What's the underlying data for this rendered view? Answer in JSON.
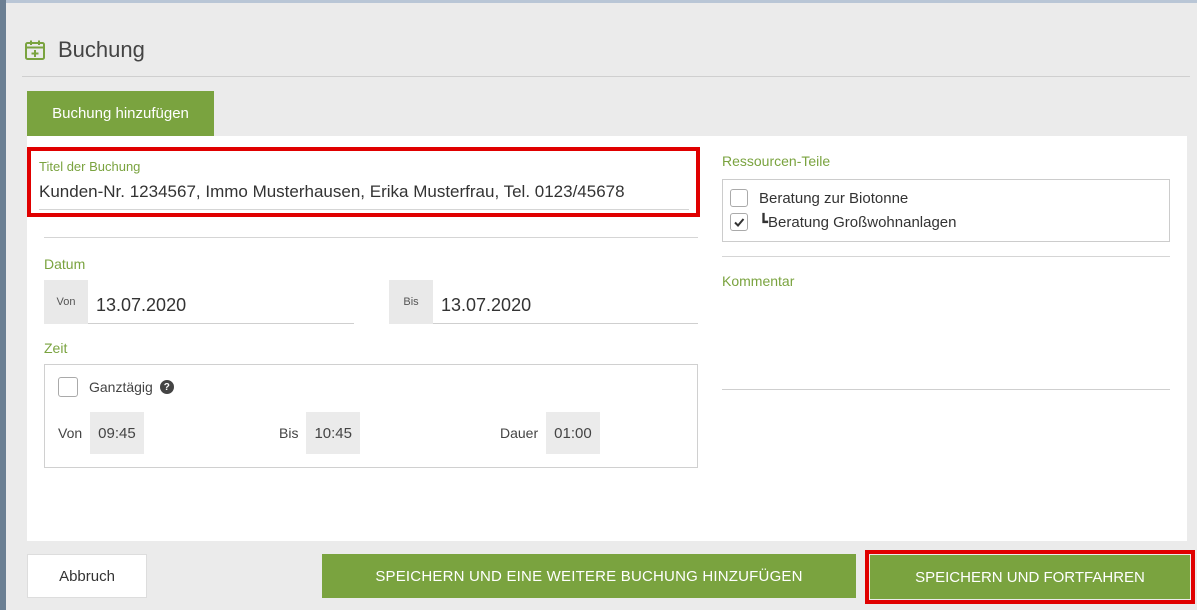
{
  "header": {
    "title": "Buchung",
    "icon": "calendar-plus-icon"
  },
  "tab": {
    "label": "Buchung hinzufügen"
  },
  "form": {
    "title_field": {
      "label": "Titel der Buchung",
      "value": "Kunden-Nr. 1234567, Immo Musterhausen, Erika Musterfrau, Tel. 0123/45678"
    },
    "datum": {
      "label": "Datum",
      "from_prefix": "Von",
      "from_value": "13.07.2020",
      "to_prefix": "Bis",
      "to_value": "13.07.2020"
    },
    "zeit": {
      "label": "Zeit",
      "allday_label": "Ganztägig",
      "allday_checked": false,
      "from_label": "Von",
      "from_value": "09:45",
      "to_label": "Bis",
      "to_value": "10:45",
      "duration_label": "Dauer",
      "duration_value": "01:00"
    },
    "resources": {
      "label": "Ressourcen-Teile",
      "items": [
        {
          "label": "Beratung zur Biotonne",
          "checked": false
        },
        {
          "label": "┗Beratung Großwohnanlagen",
          "checked": true
        }
      ]
    },
    "comment": {
      "label": "Kommentar"
    }
  },
  "buttons": {
    "cancel": "Abbruch",
    "save_and_add": "SPEICHERN UND EINE WEITERE BUCHUNG HINZUFÜGEN",
    "save_and_continue": "SPEICHERN UND FORTFAHREN"
  },
  "colors": {
    "accent": "#7aa33f",
    "highlight": "#e00000"
  }
}
